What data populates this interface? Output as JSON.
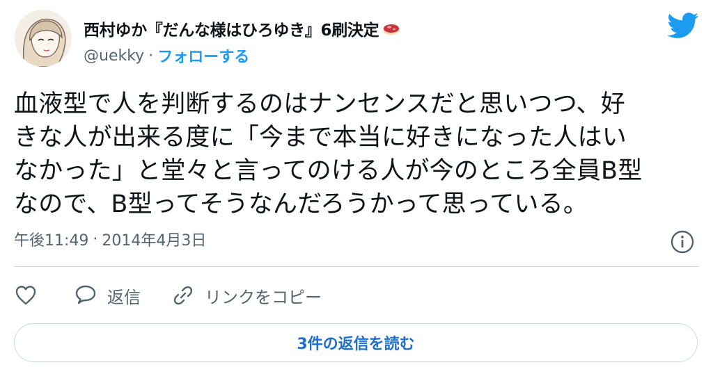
{
  "author": {
    "display_name": "西村ゆか『だんな様はひろゆき』6刷決定",
    "emoji": "meat-emoji",
    "handle": "@uekky",
    "separator": "·",
    "follow_label": "フォローする",
    "avatar": "avatar-illustration"
  },
  "brand": {
    "logo": "twitter-bird-icon",
    "color": "#1d9bf0"
  },
  "tweet": {
    "text": "血液型で人を判断するのはナンセンスだと思いつつ、好\nきな人が出来る度に「今まで本当に好きになった人はい\nなかった」と堂々と言ってのける人が今のところ全員B型\nなので、B型ってそうなんだろうかって思っている。",
    "time": "午後11:49",
    "separator": "·",
    "date": "2014年4月3日",
    "info_icon": "info-icon"
  },
  "actions": {
    "like_icon": "heart-icon",
    "reply_icon": "speech-bubble-icon",
    "reply_label": "返信",
    "link_icon": "link-icon",
    "copy_link_label": "リンクをコピー"
  },
  "replies": {
    "read_label": "3件の返信を読む"
  },
  "colors": {
    "text": "#0f1419",
    "secondary": "#536471",
    "accent": "#1d9bf0",
    "border": "#cfd9de"
  }
}
